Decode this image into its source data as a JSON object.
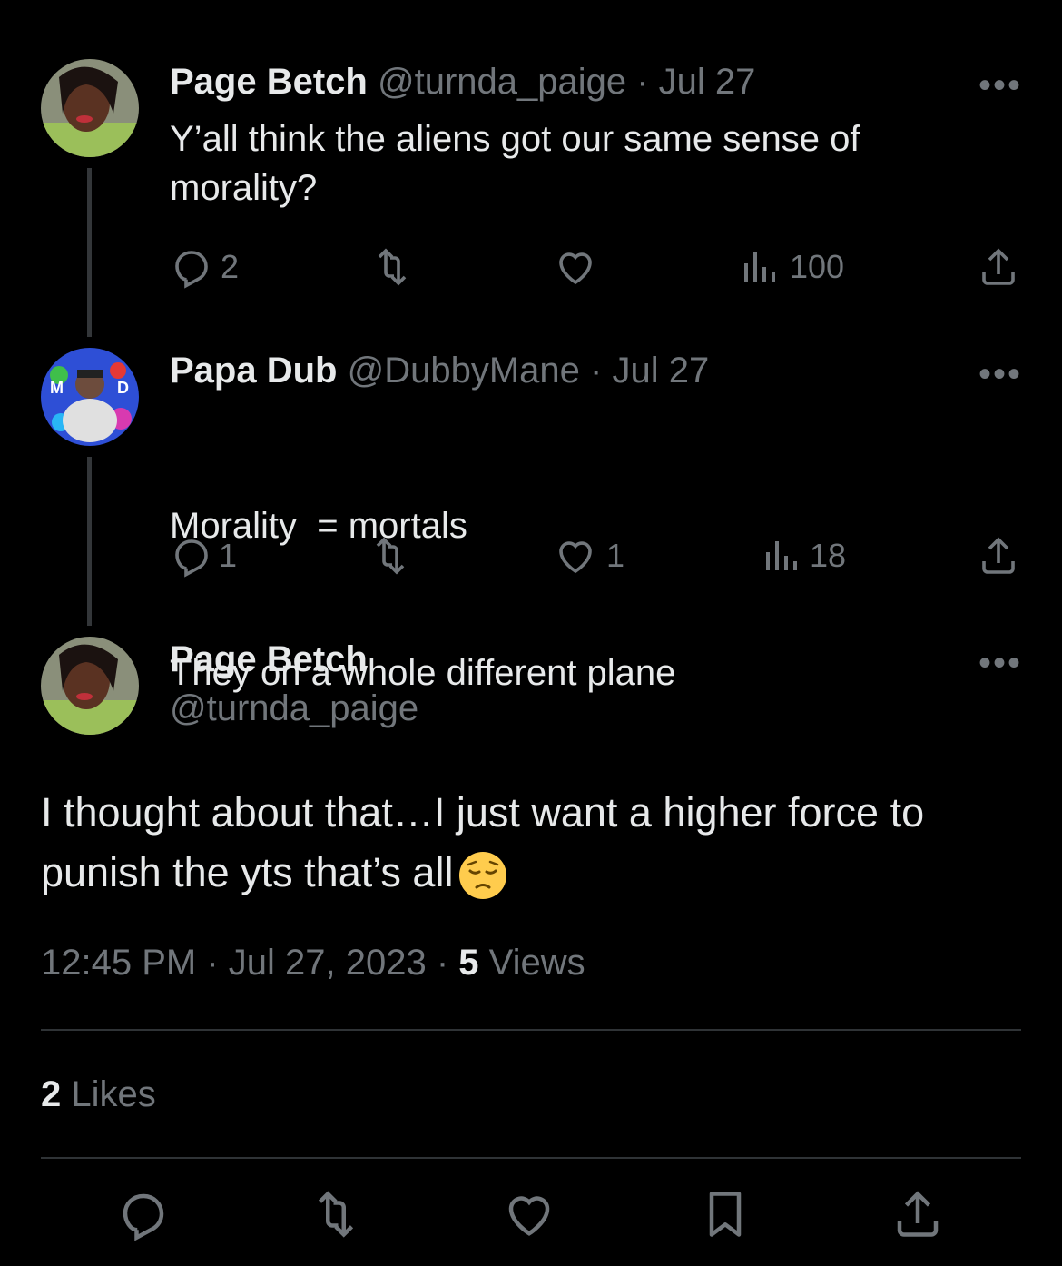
{
  "tweets": [
    {
      "name": "Page Betch",
      "handle": "@turnda_paige",
      "date": "· Jul 27",
      "text_line1": "Y’all think the aliens got our same sense of",
      "text_line2": "morality?",
      "replies": "2",
      "retweets": "",
      "likes": "",
      "views": "100"
    },
    {
      "name": "Papa Dub",
      "handle": "@DubbyMane",
      "date": "· Jul 27",
      "text_line1": "Morality  = mortals",
      "text_line2": "They on a whole different plane",
      "replies": "1",
      "retweets": "",
      "likes": "1",
      "views": "18"
    }
  ],
  "main_tweet": {
    "name": "Page Betch",
    "handle": "@turnda_paige",
    "text_line1": "I thought about that…I just want a higher force to",
    "text_line2": "punish the yts that’s all",
    "emoji": "pensive-face",
    "time": "12:45 PM · Jul 27, 2023 · ",
    "views_count": "5",
    "views_label": " Views",
    "likes_count": "2",
    "likes_label": " Likes"
  },
  "more_glyph": "•••",
  "colors": {
    "background": "#000000",
    "text": "#e7e9ea",
    "muted": "#71767b",
    "divider": "#2f3336"
  }
}
